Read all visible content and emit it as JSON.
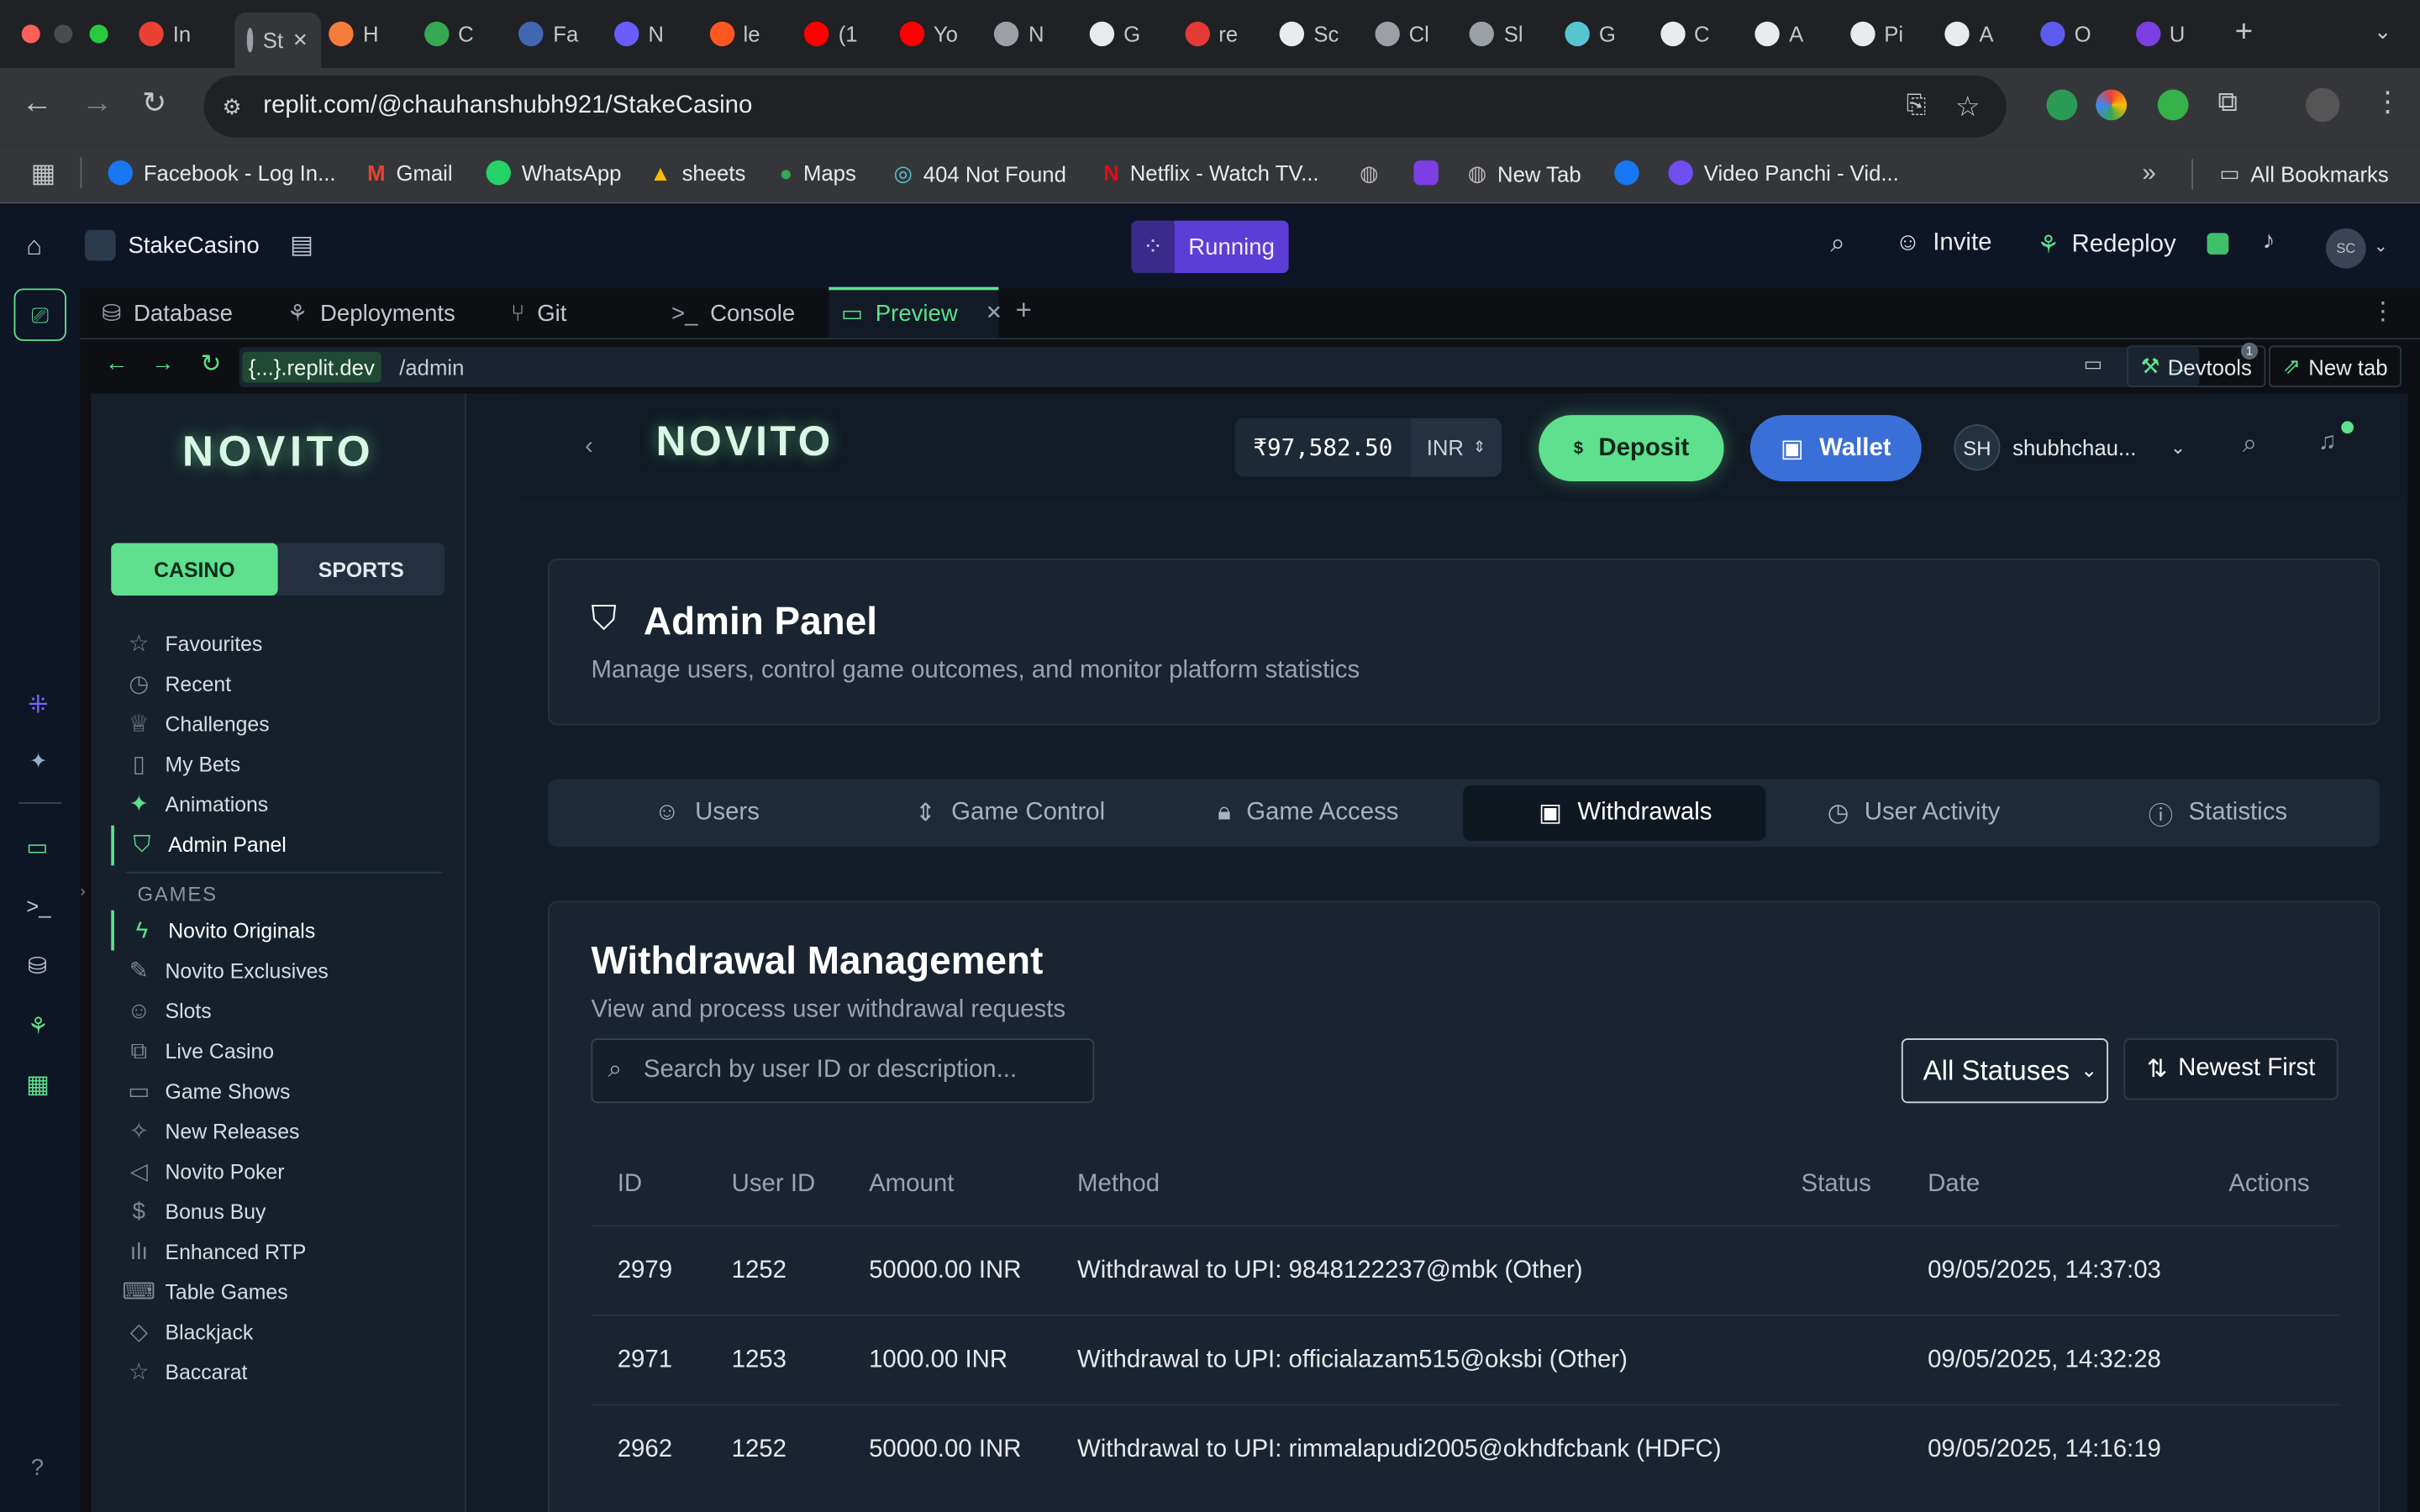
{
  "browser": {
    "tabs": [
      "In",
      "St",
      "H",
      "C",
      "Fa",
      "N",
      "le",
      "(1",
      "Yo",
      "N",
      "G",
      "re",
      "Sc",
      "Cl",
      "Sl",
      "G",
      "C",
      "A",
      "Pi",
      "A",
      "O",
      "U"
    ],
    "url": "replit.com/@chauhanshubh921/StakeCasino",
    "bookmarks": [
      "Facebook - Log In...",
      "Gmail",
      "WhatsApp",
      "sheets",
      "Maps",
      "404 Not Found",
      "Netflix - Watch TV...",
      "New Tab",
      "Video Panchi - Vid..."
    ],
    "all_bookmarks": "All Bookmarks"
  },
  "replit": {
    "project": "StakeCasino",
    "status": "Running",
    "invite": "Invite",
    "redeploy": "Redeploy",
    "avatar": "SC",
    "tabs": [
      "Database",
      "Deployments",
      "Git",
      "Console",
      "Preview"
    ],
    "preview_host": "{...}.replit.dev",
    "preview_path": "/admin",
    "devtools": "Devtools",
    "devtools_badge": "1",
    "new_tab": "New tab"
  },
  "app": {
    "logo": "NOVITO",
    "header_logo": "NOVITO",
    "balance": "₹97,582.50",
    "currency": "INR",
    "deposit": "Deposit",
    "wallet": "Wallet",
    "user_initials": "SH",
    "username": "shubhchau...",
    "toggle": {
      "casino": "CASINO",
      "sports": "SPORTS"
    },
    "nav": [
      "Favourites",
      "Recent",
      "Challenges",
      "My Bets",
      "Animations",
      "Admin Panel"
    ],
    "games_heading": "GAMES",
    "games": [
      "Novito Originals",
      "Novito Exclusives",
      "Slots",
      "Live Casino",
      "Game Shows",
      "New Releases",
      "Novito Poker",
      "Bonus Buy",
      "Enhanced RTP",
      "Table Games",
      "Blackjack",
      "Baccarat"
    ]
  },
  "admin": {
    "title": "Admin Panel",
    "subtitle": "Manage users, control game outcomes, and monitor platform statistics",
    "tabs": [
      "Users",
      "Game Control",
      "Game Access",
      "Withdrawals",
      "User Activity",
      "Statistics"
    ],
    "active_tab": "Withdrawals"
  },
  "withdrawals": {
    "title": "Withdrawal Management",
    "subtitle": "View and process user withdrawal requests",
    "search_placeholder": "Search by user ID or description...",
    "status_filter": "All Statuses",
    "sort": "Newest First",
    "columns": [
      "ID",
      "User ID",
      "Amount",
      "Method",
      "Status",
      "Date",
      "Actions"
    ],
    "rows": [
      {
        "id": "2979",
        "user_id": "1252",
        "amount": "50000.00 INR",
        "method": "Withdrawal to UPI: 9848122237@mbk (Other)",
        "date": "09/05/2025, 14:37:03"
      },
      {
        "id": "2971",
        "user_id": "1253",
        "amount": "1000.00 INR",
        "method": "Withdrawal to UPI: officialazam515@oksbi (Other)",
        "date": "09/05/2025, 14:32:28"
      },
      {
        "id": "2962",
        "user_id": "1252",
        "amount": "50000.00 INR",
        "method": "Withdrawal to UPI: rimmalapudi2005@okhdfcbank (HDFC)",
        "date": "09/05/2025, 14:16:19"
      }
    ]
  },
  "colors": {
    "accent_green": "#5ee08e",
    "wallet_blue": "#3b6fd8",
    "running_purple": "#5b3ed6"
  }
}
